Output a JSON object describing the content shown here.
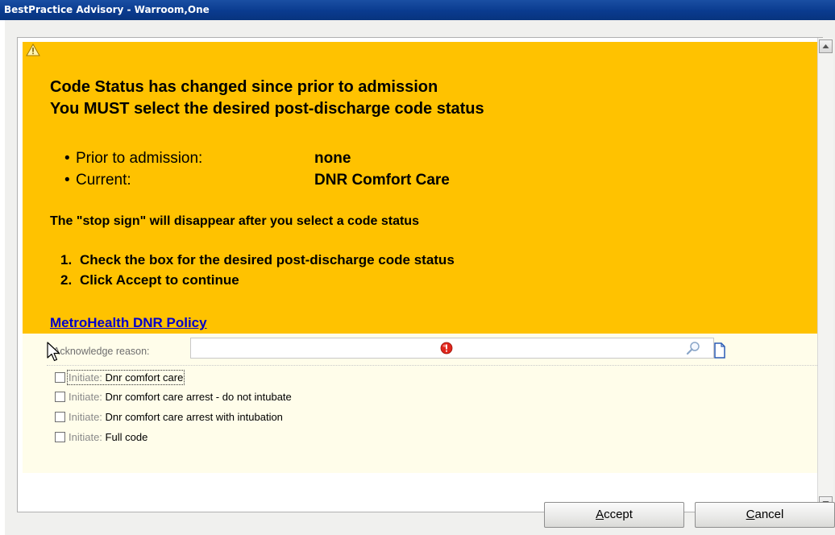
{
  "window": {
    "title": "BestPractice Advisory - Warroom,One"
  },
  "advisory": {
    "heading_line1": "Code Status has changed since prior to admission",
    "heading_line2": "You MUST select the desired post-discharge code status",
    "status_rows": [
      {
        "label": "Prior to admission:",
        "value": "none"
      },
      {
        "label": "Current:",
        "value": "DNR Comfort Care"
      }
    ],
    "stop_sign_note": "The \"stop sign\" will disappear after you select a code status",
    "steps": [
      {
        "num": "1.",
        "text": "Check the box for the desired post-discharge code status"
      },
      {
        "num": "2.",
        "text": "Click Accept to continue"
      }
    ],
    "policy_link": "MetroHealth DNR Policy",
    "icon": "warning-icon",
    "background_color": "#ffc200"
  },
  "acknowledge": {
    "label": "Acknowledge reason:",
    "value": "",
    "required_icon": "required-icon",
    "search_icon": "search-icon",
    "document_icon": "document-icon"
  },
  "options": [
    {
      "prefix": "Initiate:",
      "label": "Dnr comfort care",
      "checked": false
    },
    {
      "prefix": "Initiate:",
      "label": "Dnr comfort care arrest - do not intubate",
      "checked": false
    },
    {
      "prefix": "Initiate:",
      "label": "Dnr comfort care arrest with intubation",
      "checked": false
    },
    {
      "prefix": "Initiate:",
      "label": "Full code",
      "checked": false
    }
  ],
  "buttons": {
    "accept_mnemonic": "A",
    "accept_rest": "ccept",
    "cancel_mnemonic": "C",
    "cancel_rest": "ancel"
  },
  "colors": {
    "titlebar": "#0a3b8f",
    "link": "#0000cc",
    "ack_panel": "#fffdea"
  }
}
